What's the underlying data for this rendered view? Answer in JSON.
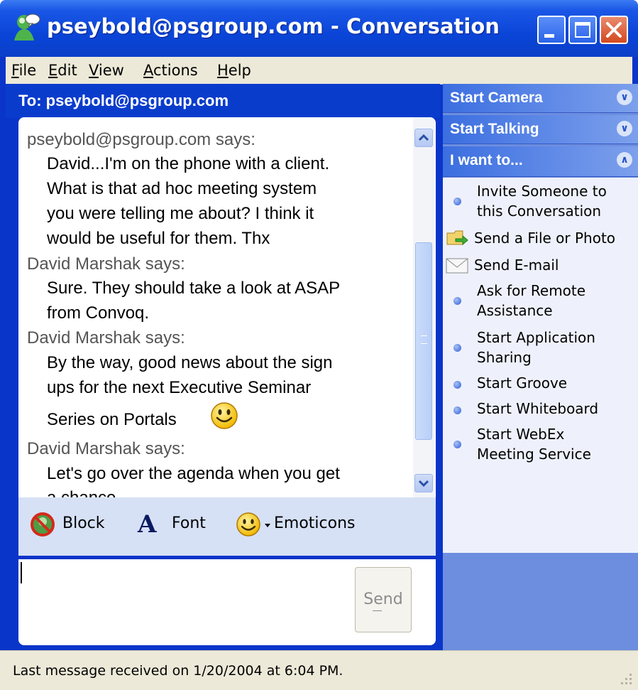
{
  "window": {
    "title": "pseybold@psgroup.com - Conversation"
  },
  "menu": {
    "items": [
      {
        "label": "File",
        "key": "F"
      },
      {
        "label": "Edit",
        "key": "E"
      },
      {
        "label": "View",
        "key": "V"
      },
      {
        "label": "Actions",
        "key": "A"
      },
      {
        "label": "Help",
        "key": "H"
      }
    ]
  },
  "to_bar": {
    "label": "To:  pseybold@psgroup.com"
  },
  "conversation": {
    "messages": [
      {
        "sender": "pseybold@psgroup.com says:",
        "lines": [
          "David...I'm on the phone with a client.",
          "What is that ad hoc meeting system",
          "you were telling me about? I think it",
          "would be useful for them. Thx"
        ]
      },
      {
        "sender": "David Marshak says:",
        "lines": [
          "Sure. They should take a look at ASAP",
          "from Convoq."
        ]
      },
      {
        "sender": "David Marshak says:",
        "lines": [
          "By the way, good news about the sign",
          "ups for the next Executive Seminar",
          "Series on Portals"
        ]
      },
      {
        "sender": "David Marshak says:",
        "lines": [
          "Let's go over the agenda when you get",
          "a chance"
        ]
      }
    ]
  },
  "toolbar": {
    "block_label": "Block",
    "font_label": "Font",
    "emoticons_label": "Emoticons"
  },
  "input": {
    "value": "",
    "send_label": "Send"
  },
  "right_panel": {
    "sections": [
      {
        "label": "Start Camera",
        "expanded": false
      },
      {
        "label": "Start Talking",
        "expanded": false
      },
      {
        "label": "I want to...",
        "expanded": true
      }
    ],
    "tasks": [
      {
        "icon": "bullet-icon",
        "lines": [
          "Invite Someone to",
          "this Conversation"
        ]
      },
      {
        "icon": "send-file-icon",
        "lines": [
          "Send a File or Photo"
        ]
      },
      {
        "icon": "envelope-icon",
        "lines": [
          "Send E-mail"
        ]
      },
      {
        "icon": "bullet-icon",
        "lines": [
          "Ask for Remote",
          "Assistance"
        ]
      },
      {
        "icon": "bullet-icon",
        "lines": [
          "Start Application",
          "Sharing"
        ]
      },
      {
        "icon": "bullet-icon",
        "lines": [
          "Start Groove"
        ]
      },
      {
        "icon": "bullet-icon",
        "lines": [
          "Start Whiteboard"
        ]
      },
      {
        "icon": "bullet-icon",
        "lines": [
          "Start WebEx",
          "Meeting Service"
        ]
      }
    ]
  },
  "status_bar": {
    "text": "Last message received on 1/20/2004 at 6:04 PM."
  },
  "colors": {
    "titlebar": "#0a45d8",
    "window_frame": "#0a35c9",
    "right_panel": "#6d8edf",
    "menu_bg": "#ece9d8"
  }
}
